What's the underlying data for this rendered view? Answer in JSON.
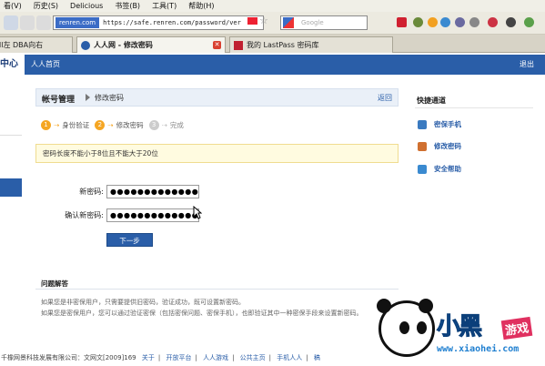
{
  "browser": {
    "menu": [
      "看(V)",
      "历史(S)",
      "Delicious",
      "书签(B)",
      "工具(T)",
      "帮助(H)"
    ],
    "url_site": "renren.com",
    "url": "https://safe.renren.com/password/ver",
    "search_placeholder": "Google",
    "tabs": [
      {
        "label": "ll左 DBA向右",
        "active": false
      },
      {
        "label": "人人网 - 修改密码",
        "active": true
      },
      {
        "label": "我的 LastPass 密码库",
        "active": false
      }
    ]
  },
  "header": {
    "left_cut": "中心",
    "home": "人人首页",
    "logout": "退出"
  },
  "main": {
    "section_title": "帐号管理",
    "section_sub": "修改密码",
    "back": "返回",
    "steps": [
      {
        "num": "1",
        "label": "身份验证",
        "done": true
      },
      {
        "num": "2",
        "label": "修改密码",
        "done": true
      },
      {
        "num": "3",
        "label": "完成",
        "done": false
      }
    ],
    "notice": "密码长度不能小于8位且不能大于20位",
    "new_password_label": "新密码:",
    "new_password_value": "●●●●●●●●●●●●●",
    "confirm_password_label": "确认新密码:",
    "confirm_password_value": "●●●●●●●●●●●●●",
    "next_button": "下一步",
    "faq_title": "问题解答",
    "faq_1": "如果您是非密保用户，只需要提供旧密码，验证成功，既可设置新密码。",
    "faq_2": "如果您是密保用户，您可以通过验证密保（包括密保问题、密保手机），也即验证其中一种密保手段来设置新密码。"
  },
  "sidebar": {
    "title": "快捷通道",
    "links": [
      "密保手机",
      "修改密码",
      "安全帮助"
    ]
  },
  "footer": {
    "company": "千橡网景科技发展有限公司：文网文[2009]169",
    "links": [
      "关于",
      "开放平台",
      "人人游戏",
      "公共主页",
      "手机人人",
      "稿"
    ]
  },
  "watermark": {
    "logo_text": "小黑",
    "game_text": "游戏",
    "url_text": "www.xiaohei.com"
  },
  "colors": {
    "brand_blue": "#2a5ea8",
    "step_orange": "#f5a623",
    "notice_bg": "#fffbe0"
  }
}
